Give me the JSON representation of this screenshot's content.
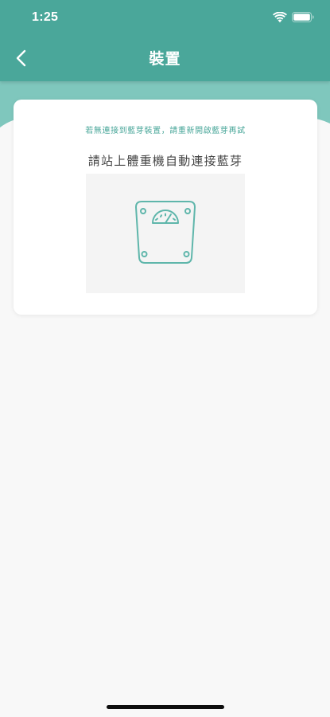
{
  "status_bar": {
    "time": "1:25",
    "wifi_icon": "wifi-icon",
    "battery_icon": "battery-icon"
  },
  "nav": {
    "back_icon": "chevron-left-icon",
    "title": "裝置"
  },
  "colors": {
    "primary": "#4aa79a",
    "primary_light": "#7fc7bd",
    "background": "#f8f8f8",
    "card": "#ffffff",
    "image_placeholder": "#f4f4f4",
    "scale_stroke": "#5fb6ab"
  },
  "device_card": {
    "hint": "若無連接到藍芽裝置，請重新開啟藍芽再試",
    "instruction": "請站上體重機自動連接藍芽",
    "image_icon": "weighing-scale-icon"
  }
}
